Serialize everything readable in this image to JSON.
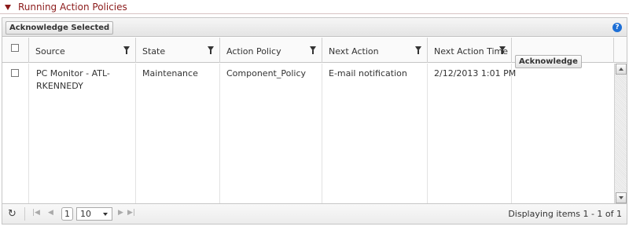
{
  "section": {
    "title": "Running Action Policies"
  },
  "toolbar": {
    "acknowledge_selected": "Acknowledge Selected",
    "help": "?"
  },
  "columns": {
    "source": "Source",
    "state": "State",
    "action_policy": "Action Policy",
    "next_action": "Next Action",
    "next_action_time": "Next Action Time"
  },
  "rows": [
    {
      "source_line1": "PC Monitor - ATL-",
      "source_line2": "RKENNEDY",
      "state": "Maintenance",
      "action_policy": "Component_Policy",
      "next_action": "E-mail notification",
      "next_action_time": "2/12/2013 1:01 PM",
      "acknowledge": "Acknowledge"
    }
  ],
  "pager": {
    "refresh": "↻",
    "first": "|◀",
    "prev": "◀",
    "page": "1",
    "page_size": "10",
    "next": "▶",
    "last": "▶|",
    "display": "Displaying items 1 - 1 of 1"
  },
  "colors": {
    "accent": "#8b1a1a",
    "help": "#1d6fd6"
  }
}
